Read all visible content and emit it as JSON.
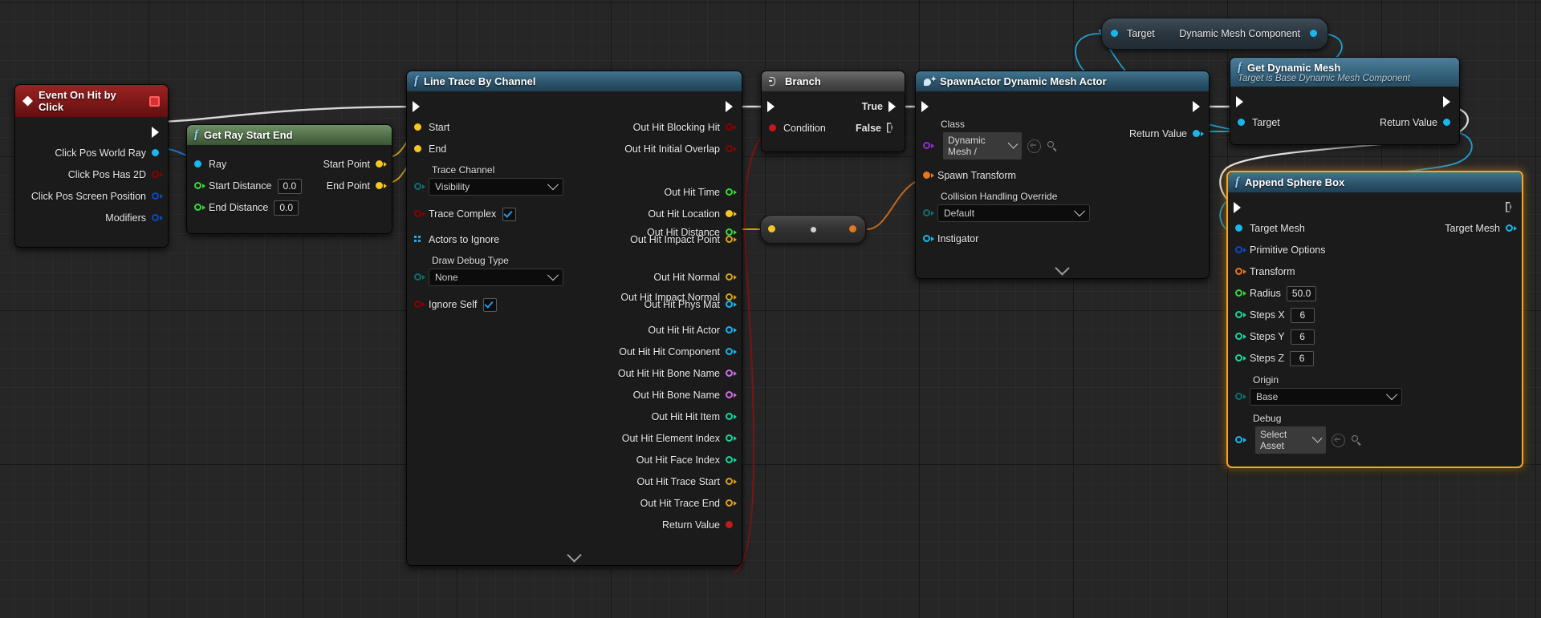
{
  "canvas": {
    "bg": "#262626",
    "grid_minor": 24,
    "grid_major": 192
  },
  "colors": {
    "exec_white": "#ffffff",
    "bool_red": "#8c0000",
    "float_green": "#39d83c",
    "int_teal": "#1ad6a0",
    "vector_yellow": "#f7c623",
    "transform_orange": "#e8761a",
    "object_blue": "#18b7f0",
    "struct_darkblue": "#0a49c8",
    "name_magenta": "#cf6fe8",
    "byte_teal": "#0a6f6f",
    "class_purple": "#8e2fd8",
    "selection_orange": "#f5a623"
  },
  "nodes": {
    "event_on_hit_by_click": {
      "title": "Event On Hit by Click",
      "outputs": [
        {
          "label": "Click Pos World Ray",
          "type": "object_blue",
          "filled": true
        },
        {
          "label": "Click Pos Has 2D",
          "type": "bool_red",
          "filled": false
        },
        {
          "label": "Click Pos Screen Position",
          "type": "struct_darkblue",
          "filled": false
        },
        {
          "label": "Modifiers",
          "type": "struct_darkblue",
          "filled": false
        }
      ]
    },
    "get_ray_start_end": {
      "title": "Get Ray Start End",
      "inputs": [
        {
          "label": "Ray",
          "type": "object_blue",
          "filled": true,
          "value": null
        },
        {
          "label": "Start Distance",
          "type": "float_green",
          "filled": false,
          "value": "0.0"
        },
        {
          "label": "End Distance",
          "type": "float_green",
          "filled": false,
          "value": "0.0"
        }
      ],
      "outputs": [
        {
          "label": "Start Point",
          "type": "vector_yellow",
          "filled": true
        },
        {
          "label": "End Point",
          "type": "vector_yellow",
          "filled": true
        }
      ]
    },
    "line_trace_by_channel": {
      "title": "Line Trace By Channel",
      "inputs": [
        {
          "label": "Start",
          "type": "vector_yellow",
          "filled": true,
          "widget": null
        },
        {
          "label": "End",
          "type": "vector_yellow",
          "filled": true,
          "widget": null
        },
        {
          "label": "Trace Channel",
          "type": "byte_teal",
          "filled": false,
          "widget": "combo",
          "value": "Visibility"
        },
        {
          "label": "Trace Complex",
          "type": "bool_red",
          "filled": false,
          "widget": "checkbox",
          "value": true
        },
        {
          "label": "Actors to Ignore",
          "type": "array_blue",
          "filled": false,
          "widget": null
        },
        {
          "label": "Draw Debug Type",
          "type": "byte_teal",
          "filled": false,
          "widget": "combo",
          "value": "None"
        },
        {
          "label": "Ignore Self",
          "type": "bool_red",
          "filled": false,
          "widget": "checkbox",
          "value": true
        }
      ],
      "outputs": [
        {
          "label": "Out Hit Blocking Hit",
          "type": "bool_red",
          "filled": false
        },
        {
          "label": "Out Hit Initial Overlap",
          "type": "bool_red",
          "filled": false
        },
        {
          "label": "Out Hit Time",
          "type": "float_green",
          "filled": false
        },
        {
          "label": "Out Hit Distance",
          "type": "float_green",
          "filled": false
        },
        {
          "label": "Out Hit Location",
          "type": "vector_yellow",
          "filled": true
        },
        {
          "label": "Out Hit Impact Point",
          "type": "vector_yellow",
          "filled": false
        },
        {
          "label": "Out Hit Normal",
          "type": "vector_yellow",
          "filled": false
        },
        {
          "label": "Out Hit Impact Normal",
          "type": "vector_yellow",
          "filled": false
        },
        {
          "label": "Out Hit Phys Mat",
          "type": "object_blue",
          "filled": false
        },
        {
          "label": "Out Hit Hit Actor",
          "type": "object_blue",
          "filled": false
        },
        {
          "label": "Out Hit Hit Component",
          "type": "object_blue",
          "filled": false
        },
        {
          "label": "Out Hit Hit Bone Name",
          "type": "name_magenta",
          "filled": false
        },
        {
          "label": "Out Hit Bone Name",
          "type": "name_magenta",
          "filled": false
        },
        {
          "label": "Out Hit Hit Item",
          "type": "int_teal",
          "filled": false
        },
        {
          "label": "Out Hit Element Index",
          "type": "int_teal",
          "filled": false
        },
        {
          "label": "Out Hit Face Index",
          "type": "int_teal",
          "filled": false
        },
        {
          "label": "Out Hit Trace Start",
          "type": "vector_yellow",
          "filled": false
        },
        {
          "label": "Out Hit Trace End",
          "type": "vector_yellow",
          "filled": false
        },
        {
          "label": "Return Value",
          "type": "bool_red",
          "filled": true
        }
      ]
    },
    "branch": {
      "title": "Branch",
      "inputs": [
        {
          "label": "Condition",
          "type": "bool_red",
          "filled": true
        }
      ],
      "outputs": [
        {
          "label": "True"
        },
        {
          "label": "False"
        }
      ]
    },
    "spawn_actor": {
      "title": "SpawnActor Dynamic Mesh Actor",
      "inputs": [
        {
          "label": "Class",
          "type": "class_purple",
          "widget": "combo_asset",
          "value": "Dynamic Mesh /"
        },
        {
          "label": "Spawn Transform",
          "type": "transform_orange",
          "filled": true
        },
        {
          "label": "Collision Handling Override",
          "type": "byte_teal",
          "widget": "combo",
          "value": "Default"
        },
        {
          "label": "Instigator",
          "type": "object_blue",
          "filled": false
        }
      ],
      "outputs": [
        {
          "label": "Return Value",
          "type": "object_blue",
          "filled": true
        }
      ]
    },
    "dynamic_mesh_component": {
      "input_label": "Target",
      "output_label": "Dynamic Mesh Component"
    },
    "get_dynamic_mesh": {
      "title": "Get Dynamic Mesh",
      "subtitle": "Target is Base Dynamic Mesh Component",
      "inputs": [
        {
          "label": "Target",
          "type": "object_blue",
          "filled": true
        }
      ],
      "outputs": [
        {
          "label": "Return Value",
          "type": "object_blue",
          "filled": true
        }
      ]
    },
    "append_sphere_box": {
      "title": "Append Sphere Box",
      "selected": true,
      "inputs": [
        {
          "label": "Target Mesh",
          "type": "object_blue",
          "filled": true,
          "widget": null
        },
        {
          "label": "Primitive Options",
          "type": "struct_darkblue",
          "filled": false,
          "widget": null
        },
        {
          "label": "Transform",
          "type": "transform_orange",
          "filled": false,
          "widget": null
        },
        {
          "label": "Radius",
          "type": "float_green",
          "filled": false,
          "widget": "num",
          "value": "50.0"
        },
        {
          "label": "Steps X",
          "type": "int_teal",
          "filled": false,
          "widget": "num",
          "value": "6"
        },
        {
          "label": "Steps Y",
          "type": "int_teal",
          "filled": false,
          "widget": "num",
          "value": "6"
        },
        {
          "label": "Steps Z",
          "type": "int_teal",
          "filled": false,
          "widget": "num",
          "value": "6"
        },
        {
          "label": "Origin",
          "type": "byte_teal",
          "filled": false,
          "widget": "combo",
          "value": "Base"
        },
        {
          "label": "Debug",
          "type": "object_blue",
          "filled": false,
          "widget": "combo_asset",
          "value": "Select Asset"
        }
      ],
      "outputs": [
        {
          "label": "Target Mesh",
          "type": "object_blue",
          "filled": false
        }
      ]
    }
  }
}
